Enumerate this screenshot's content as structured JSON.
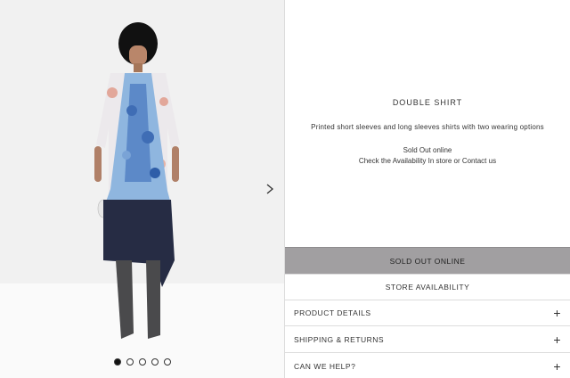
{
  "product": {
    "title": "DOUBLE SHIRT",
    "description": "Printed short sleeves and long sleeves shirts with two wearing options",
    "stock_status": "Sold Out online",
    "availability_text": "Check the Availability In store or Contact us"
  },
  "actions": {
    "sold_out_label": "SOLD OUT ONLINE",
    "store_availability_label": "STORE AVAILABILITY"
  },
  "accordion": {
    "items": [
      {
        "label": "PRODUCT DETAILS",
        "icon": "plus-icon"
      },
      {
        "label": "SHIPPING & RETURNS",
        "icon": "plus-icon"
      },
      {
        "label": "CAN WE HELP?",
        "icon": "plus-icon"
      }
    ]
  },
  "gallery": {
    "image_count": 5,
    "active_index": 0,
    "next_icon": "chevron-right-icon"
  },
  "colors": {
    "sold_out_bg": "#a19fa1",
    "border": "#dcdcdc"
  }
}
